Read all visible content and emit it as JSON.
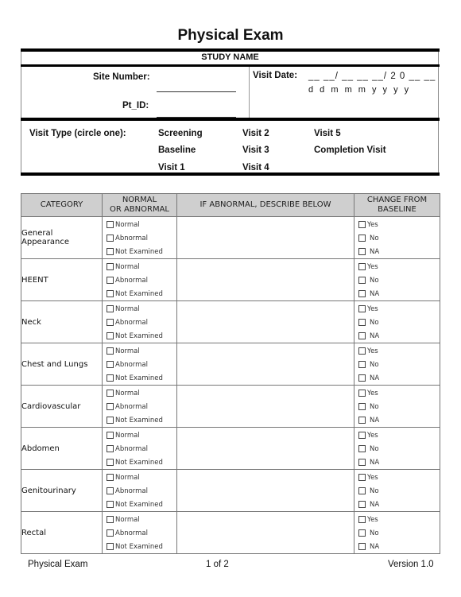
{
  "title": "Physical Exam",
  "study_name": "STUDY NAME",
  "header": {
    "site_number_label": "Site Number:",
    "pt_id_label": "Pt_ID:",
    "visit_date_label": "Visit Date:",
    "visit_date_template": "__ __/ __ __ __/ 2 0 __ __",
    "visit_date_format": "d d  m m m  y y y y"
  },
  "visit_type": {
    "label": "Visit Type (circle one):",
    "options": [
      "Screening",
      "Baseline",
      "Visit 1",
      "Visit 2",
      "Visit 3",
      "Visit 4",
      "Visit 5",
      "Completion Visit"
    ]
  },
  "table": {
    "headers": [
      "CATEGORY",
      "NORMAL\nOR ABNORMAL",
      "IF ABNORMAL, DESCRIBE BELOW",
      "CHANGE FROM\nBASELINE"
    ],
    "status_options": [
      "Normal",
      "Abnormal",
      "Not Examined"
    ],
    "change_options": [
      "Yes",
      "No",
      "NA"
    ],
    "rows": [
      {
        "category": "General Appearance"
      },
      {
        "category": "HEENT"
      },
      {
        "category": "Neck"
      },
      {
        "category": "Chest and Lungs"
      },
      {
        "category": "Cardiovascular"
      },
      {
        "category": "Abdomen"
      },
      {
        "category": "Genitourinary"
      },
      {
        "category": "Rectal"
      }
    ]
  },
  "footer": {
    "left": "Physical Exam",
    "center": "1 of 2",
    "right": "Version 1.0"
  }
}
